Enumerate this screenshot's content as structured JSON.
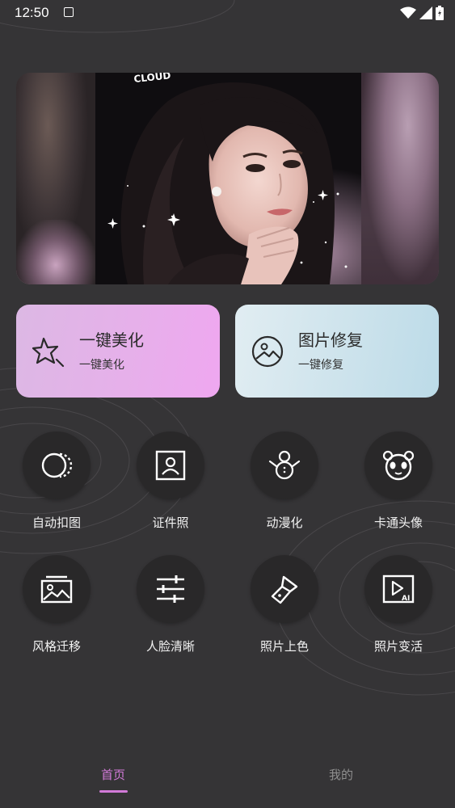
{
  "status_bar": {
    "time": "12:50",
    "icons": [
      "notification-a-icon",
      "wifi-icon",
      "signal-icon",
      "battery-icon"
    ]
  },
  "banner": {
    "photo_text": "CLOUD"
  },
  "cards": [
    {
      "title": "一键美化",
      "subtitle": "一键美化",
      "icon": "magic-star-icon"
    },
    {
      "title": "图片修复",
      "subtitle": "一键修复",
      "icon": "image-repair-icon"
    }
  ],
  "tools": [
    {
      "label": "自动扣图",
      "icon": "auto-cutout-icon"
    },
    {
      "label": "证件照",
      "icon": "id-photo-icon"
    },
    {
      "label": "动漫化",
      "icon": "snowman-icon"
    },
    {
      "label": "卡通头像",
      "icon": "panda-icon"
    },
    {
      "label": "风格迁移",
      "icon": "image-frame-icon"
    },
    {
      "label": "人脸清晰",
      "icon": "sliders-icon"
    },
    {
      "label": "照片上色",
      "icon": "flashlight-icon"
    },
    {
      "label": "照片变活",
      "icon": "ai-video-icon"
    }
  ],
  "bottom_nav": {
    "home": "首页",
    "mine": "我的"
  },
  "colors": {
    "background": "#353436",
    "accent": "#d27ad8",
    "tool_circle": "#292829",
    "card_beautify": "#e6b0ea",
    "card_repair": "#cde3ec"
  }
}
